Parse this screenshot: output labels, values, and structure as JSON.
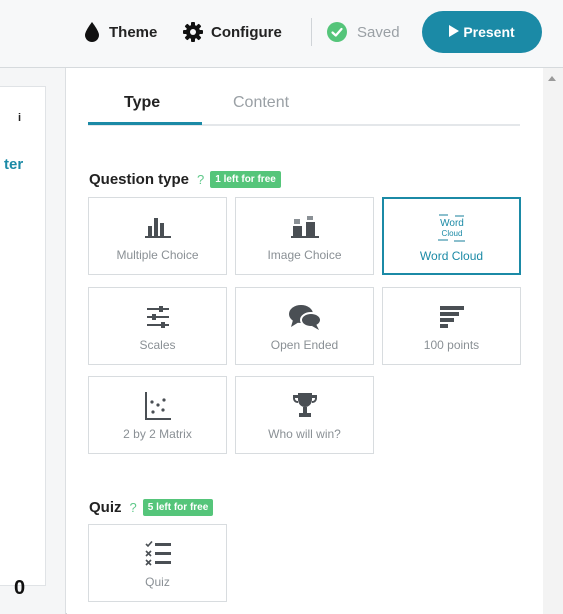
{
  "toolbar": {
    "theme_label": "Theme",
    "configure_label": "Configure",
    "saved_label": "Saved",
    "present_label": "Present"
  },
  "left_panel": {
    "info_glyph": "i",
    "partial_label": "ter",
    "counter": "0"
  },
  "tabs": [
    {
      "label": "Type",
      "active": true
    },
    {
      "label": "Content",
      "active": false
    }
  ],
  "question_type": {
    "title": "Question type",
    "help": "?",
    "badge": "1 left for free",
    "tiles": [
      {
        "label": "Multiple Choice",
        "icon": "bar-chart-icon",
        "selected": false
      },
      {
        "label": "Image Choice",
        "icon": "image-choice-icon",
        "selected": false
      },
      {
        "label": "Word Cloud",
        "icon": "word-cloud-icon",
        "selected": true
      },
      {
        "label": "Scales",
        "icon": "sliders-icon",
        "selected": false
      },
      {
        "label": "Open Ended",
        "icon": "speech-bubbles-icon",
        "selected": false
      },
      {
        "label": "100 points",
        "icon": "descending-bars-icon",
        "selected": false
      },
      {
        "label": "2 by 2 Matrix",
        "icon": "scatter-matrix-icon",
        "selected": false
      },
      {
        "label": "Who will win?",
        "icon": "trophy-icon",
        "selected": false
      }
    ]
  },
  "quiz": {
    "title": "Quiz",
    "help": "?",
    "badge": "5 left for free",
    "tiles": [
      {
        "label": "Quiz",
        "icon": "quiz-checklist-icon",
        "selected": false
      }
    ]
  },
  "word_cloud_icon_text": {
    "top": "Word",
    "bottom": "Cloud"
  },
  "colors": {
    "accent": "#1b8aa6",
    "badge_green": "#55c57a",
    "muted_text": "#8a9095"
  }
}
